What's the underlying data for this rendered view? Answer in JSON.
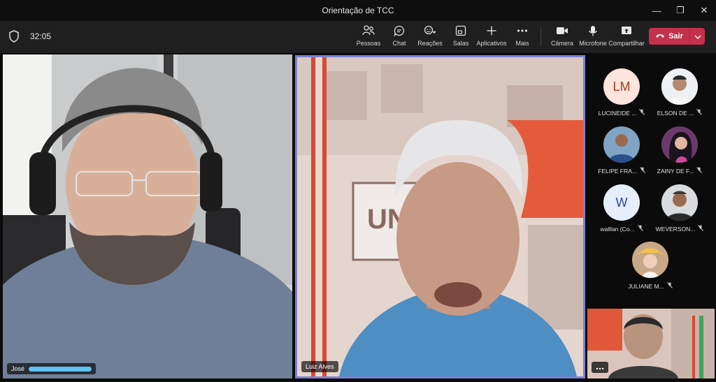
{
  "window": {
    "title": "Orientação de TCC"
  },
  "toolbar": {
    "timer": "32:05",
    "items": [
      {
        "label": "Pessoas",
        "icon": "people-icon"
      },
      {
        "label": "Chat",
        "icon": "chat-icon"
      },
      {
        "label": "Reações",
        "icon": "reactions-icon"
      },
      {
        "label": "Salas",
        "icon": "rooms-icon"
      },
      {
        "label": "Aplicativos",
        "icon": "apps-icon"
      },
      {
        "label": "Mais",
        "icon": "more-icon"
      },
      {
        "label": "Câmera",
        "icon": "camera-icon"
      },
      {
        "label": "Microfone",
        "icon": "microphone-icon"
      },
      {
        "label": "Compartilhar",
        "icon": "share-icon"
      }
    ],
    "leave_label": "Sair"
  },
  "stage": {
    "left_name": "José",
    "right_name": "Luiz Alves",
    "right_sign_text": "UNI"
  },
  "participants": [
    {
      "name": "LUCINEIDE ...",
      "initials": "LM"
    },
    {
      "name": "ELSON DE ...",
      "initials": ""
    },
    {
      "name": "FELIPE FRA...",
      "initials": ""
    },
    {
      "name": "ZAINY DE F...",
      "initials": ""
    },
    {
      "name": "walllan (Co...",
      "initials": "W"
    },
    {
      "name": "WEVERSON...",
      "initials": ""
    },
    {
      "name": "JULIANE M...",
      "initials": ""
    }
  ],
  "colors": {
    "leave": "#c4314b",
    "active_speaker_border": "#7b7fd6"
  }
}
